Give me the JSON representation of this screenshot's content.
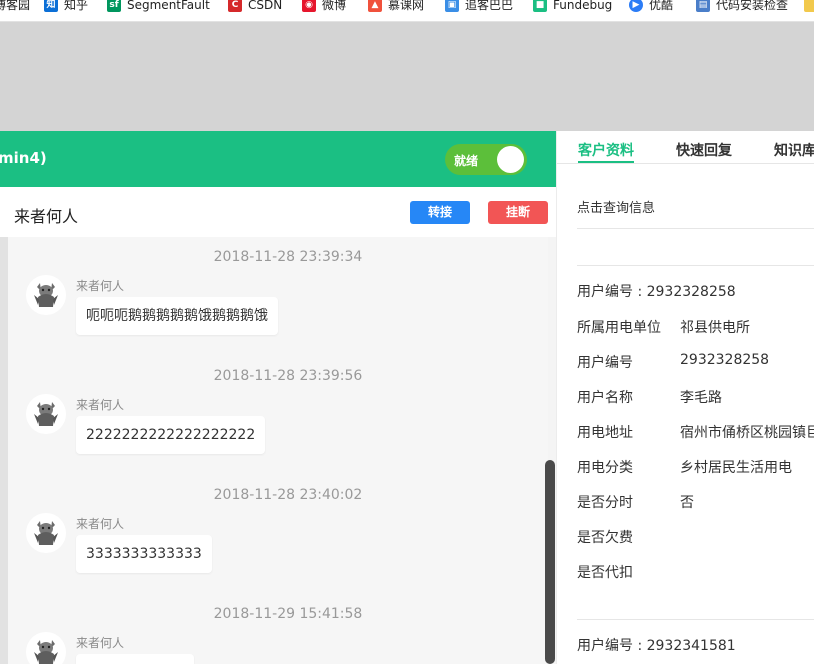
{
  "bookmarks": [
    {
      "label": "博客园",
      "icon": "cnblogs-icon",
      "color": "#ffffff",
      "text": ""
    },
    {
      "label": "知乎",
      "icon": "zhihu-icon",
      "color": "#0b6fd6",
      "text": "知"
    },
    {
      "label": "SegmentFault",
      "icon": "segmentfault-icon",
      "color": "#00965e",
      "text": "sf"
    },
    {
      "label": "CSDN",
      "icon": "csdn-icon",
      "color": "#d5292b",
      "text": "C"
    },
    {
      "label": "微博",
      "icon": "weibo-icon",
      "color": "#e6162d",
      "text": "◉"
    },
    {
      "label": "慕课网",
      "icon": "imooc-icon",
      "color": "#f0513c",
      "text": "▲"
    },
    {
      "label": "追客巴巴",
      "icon": "zhuike-icon",
      "color": "#3a8ee6",
      "text": "▣"
    },
    {
      "label": "Fundebug",
      "icon": "fundebug-icon",
      "color": "#1bbf83",
      "text": "■"
    },
    {
      "label": "优酷",
      "icon": "youku-icon",
      "color": "#2b7cf6",
      "text": "▶"
    },
    {
      "label": "代码安装检查",
      "icon": "code-check-icon",
      "color": "#4a7ec9",
      "text": "▤"
    }
  ],
  "chat": {
    "header_title": "min4)",
    "status_toggle": {
      "label": "就绪",
      "on": true
    },
    "visitor_name": "来者何人",
    "transfer_label": "转接",
    "hangup_label": "挂断",
    "messages": [
      {
        "timestamp": "2018-11-28 23:39:34",
        "sender": "来者何人",
        "text": "呃呃呃鹅鹅鹅鹅鹅饿鹅鹅鹅饿"
      },
      {
        "timestamp": "2018-11-28 23:39:56",
        "sender": "来者何人",
        "text": "2222222222222222222"
      },
      {
        "timestamp": "2018-11-28 23:40:02",
        "sender": "来者何人",
        "text": "3333333333333"
      },
      {
        "timestamp": "2018-11-29 15:41:58",
        "sender": "来者何人",
        "text": ""
      }
    ]
  },
  "right_panel": {
    "tabs": [
      {
        "label": "客户资料",
        "active": true
      },
      {
        "label": "快速回复",
        "active": false
      },
      {
        "label": "知识库",
        "active": false
      }
    ],
    "query_link": "点击查询信息",
    "records": [
      {
        "heading": "用户编号 : 2932328258",
        "fields": [
          {
            "label": "所属用电单位",
            "value": "祁县供电所"
          },
          {
            "label": "用户编号",
            "value": "2932328258"
          },
          {
            "label": "用户名称",
            "value": "李毛路"
          },
          {
            "label": "用电地址",
            "value": "宿州市俑桥区桃园镇巨"
          },
          {
            "label": "用电分类",
            "value": "乡村居民生活用电"
          },
          {
            "label": "是否分时",
            "value": "否"
          },
          {
            "label": "是否欠费",
            "value": ""
          },
          {
            "label": "是否代扣",
            "value": ""
          }
        ]
      },
      {
        "heading": "用户编号 : 2932341581",
        "fields": []
      }
    ]
  },
  "colors": {
    "brand_green": "#1bbf83",
    "toggle_green": "#5cbf3a",
    "transfer_blue": "#2687f6",
    "hangup_red": "#f25555"
  }
}
